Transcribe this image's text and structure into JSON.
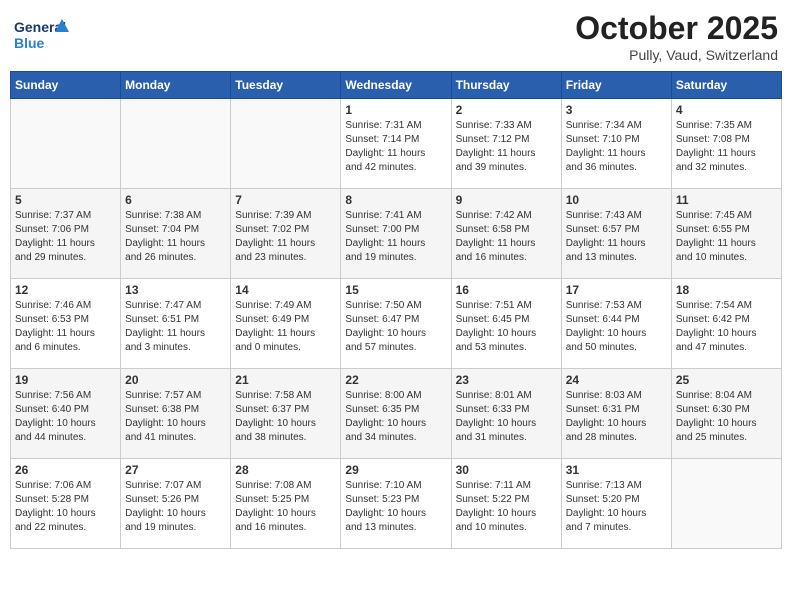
{
  "header": {
    "logo_general": "General",
    "logo_blue": "Blue",
    "month_title": "October 2025",
    "location": "Pully, Vaud, Switzerland"
  },
  "days_of_week": [
    "Sunday",
    "Monday",
    "Tuesday",
    "Wednesday",
    "Thursday",
    "Friday",
    "Saturday"
  ],
  "weeks": [
    [
      {
        "day": "",
        "info": ""
      },
      {
        "day": "",
        "info": ""
      },
      {
        "day": "",
        "info": ""
      },
      {
        "day": "1",
        "info": "Sunrise: 7:31 AM\nSunset: 7:14 PM\nDaylight: 11 hours\nand 42 minutes."
      },
      {
        "day": "2",
        "info": "Sunrise: 7:33 AM\nSunset: 7:12 PM\nDaylight: 11 hours\nand 39 minutes."
      },
      {
        "day": "3",
        "info": "Sunrise: 7:34 AM\nSunset: 7:10 PM\nDaylight: 11 hours\nand 36 minutes."
      },
      {
        "day": "4",
        "info": "Sunrise: 7:35 AM\nSunset: 7:08 PM\nDaylight: 11 hours\nand 32 minutes."
      }
    ],
    [
      {
        "day": "5",
        "info": "Sunrise: 7:37 AM\nSunset: 7:06 PM\nDaylight: 11 hours\nand 29 minutes."
      },
      {
        "day": "6",
        "info": "Sunrise: 7:38 AM\nSunset: 7:04 PM\nDaylight: 11 hours\nand 26 minutes."
      },
      {
        "day": "7",
        "info": "Sunrise: 7:39 AM\nSunset: 7:02 PM\nDaylight: 11 hours\nand 23 minutes."
      },
      {
        "day": "8",
        "info": "Sunrise: 7:41 AM\nSunset: 7:00 PM\nDaylight: 11 hours\nand 19 minutes."
      },
      {
        "day": "9",
        "info": "Sunrise: 7:42 AM\nSunset: 6:58 PM\nDaylight: 11 hours\nand 16 minutes."
      },
      {
        "day": "10",
        "info": "Sunrise: 7:43 AM\nSunset: 6:57 PM\nDaylight: 11 hours\nand 13 minutes."
      },
      {
        "day": "11",
        "info": "Sunrise: 7:45 AM\nSunset: 6:55 PM\nDaylight: 11 hours\nand 10 minutes."
      }
    ],
    [
      {
        "day": "12",
        "info": "Sunrise: 7:46 AM\nSunset: 6:53 PM\nDaylight: 11 hours\nand 6 minutes."
      },
      {
        "day": "13",
        "info": "Sunrise: 7:47 AM\nSunset: 6:51 PM\nDaylight: 11 hours\nand 3 minutes."
      },
      {
        "day": "14",
        "info": "Sunrise: 7:49 AM\nSunset: 6:49 PM\nDaylight: 11 hours\nand 0 minutes."
      },
      {
        "day": "15",
        "info": "Sunrise: 7:50 AM\nSunset: 6:47 PM\nDaylight: 10 hours\nand 57 minutes."
      },
      {
        "day": "16",
        "info": "Sunrise: 7:51 AM\nSunset: 6:45 PM\nDaylight: 10 hours\nand 53 minutes."
      },
      {
        "day": "17",
        "info": "Sunrise: 7:53 AM\nSunset: 6:44 PM\nDaylight: 10 hours\nand 50 minutes."
      },
      {
        "day": "18",
        "info": "Sunrise: 7:54 AM\nSunset: 6:42 PM\nDaylight: 10 hours\nand 47 minutes."
      }
    ],
    [
      {
        "day": "19",
        "info": "Sunrise: 7:56 AM\nSunset: 6:40 PM\nDaylight: 10 hours\nand 44 minutes."
      },
      {
        "day": "20",
        "info": "Sunrise: 7:57 AM\nSunset: 6:38 PM\nDaylight: 10 hours\nand 41 minutes."
      },
      {
        "day": "21",
        "info": "Sunrise: 7:58 AM\nSunset: 6:37 PM\nDaylight: 10 hours\nand 38 minutes."
      },
      {
        "day": "22",
        "info": "Sunrise: 8:00 AM\nSunset: 6:35 PM\nDaylight: 10 hours\nand 34 minutes."
      },
      {
        "day": "23",
        "info": "Sunrise: 8:01 AM\nSunset: 6:33 PM\nDaylight: 10 hours\nand 31 minutes."
      },
      {
        "day": "24",
        "info": "Sunrise: 8:03 AM\nSunset: 6:31 PM\nDaylight: 10 hours\nand 28 minutes."
      },
      {
        "day": "25",
        "info": "Sunrise: 8:04 AM\nSunset: 6:30 PM\nDaylight: 10 hours\nand 25 minutes."
      }
    ],
    [
      {
        "day": "26",
        "info": "Sunrise: 7:06 AM\nSunset: 5:28 PM\nDaylight: 10 hours\nand 22 minutes."
      },
      {
        "day": "27",
        "info": "Sunrise: 7:07 AM\nSunset: 5:26 PM\nDaylight: 10 hours\nand 19 minutes."
      },
      {
        "day": "28",
        "info": "Sunrise: 7:08 AM\nSunset: 5:25 PM\nDaylight: 10 hours\nand 16 minutes."
      },
      {
        "day": "29",
        "info": "Sunrise: 7:10 AM\nSunset: 5:23 PM\nDaylight: 10 hours\nand 13 minutes."
      },
      {
        "day": "30",
        "info": "Sunrise: 7:11 AM\nSunset: 5:22 PM\nDaylight: 10 hours\nand 10 minutes."
      },
      {
        "day": "31",
        "info": "Sunrise: 7:13 AM\nSunset: 5:20 PM\nDaylight: 10 hours\nand 7 minutes."
      },
      {
        "day": "",
        "info": ""
      }
    ]
  ]
}
